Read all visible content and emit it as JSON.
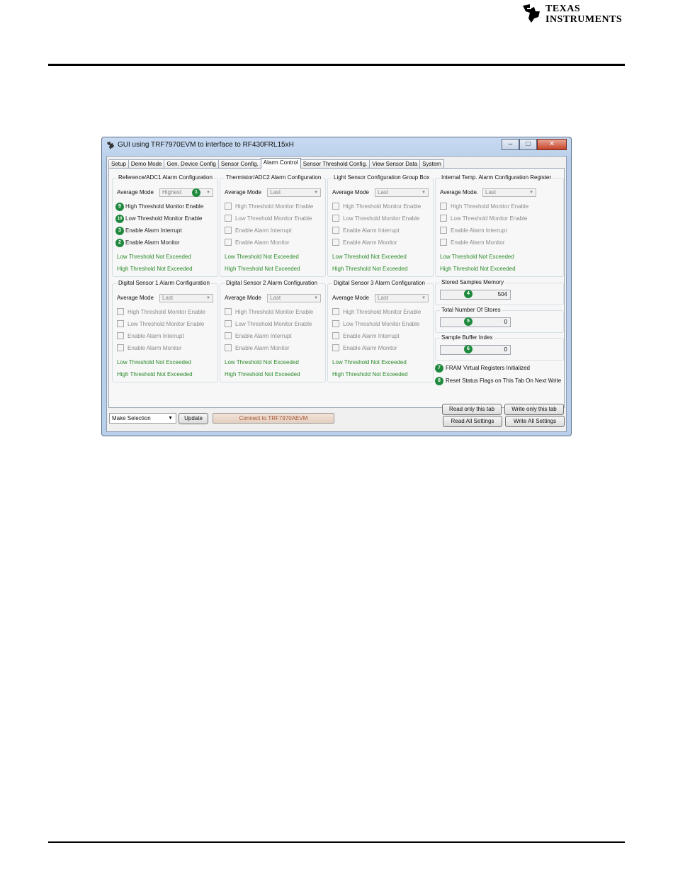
{
  "brand": {
    "word1": "TEXAS",
    "word2": "INSTRUMENTS"
  },
  "window": {
    "title": "GUI using TRF7970EVM to interface to RF430FRL15xH",
    "controls": {
      "minimize": "‒",
      "maximize": "□",
      "close": "✕"
    }
  },
  "tabs": [
    {
      "label": "Setup"
    },
    {
      "label": "Demo Mode"
    },
    {
      "label": "Gen. Device Config"
    },
    {
      "label": "Sensor Config."
    },
    {
      "label": "Alarm Control"
    },
    {
      "label": "Sensor Threshold Config."
    },
    {
      "label": "View Sensor Data"
    },
    {
      "label": "System"
    }
  ],
  "active_tab": "Alarm Control",
  "common": {
    "average_mode_label": "Average Mode",
    "high_threshold_enable": "High Threshold Monitor Enable",
    "low_threshold_enable": "Low Threshold Monitor Enable",
    "enable_alarm_interrupt": "Enable Alarm Interrupt",
    "enable_alarm_monitor": "Enable Alarm Monitor",
    "low_status": "Low Threshold Not Exceeded",
    "high_status": "High Threshold Not Exceeded"
  },
  "groups": [
    {
      "title": "Reference/ADC1 Alarm Configuration",
      "average_mode": "Highest",
      "average_mode_label": "Average Mode"
    },
    {
      "title": "Thermistor/ADC2 Alarm Configuration",
      "average_mode": "Last",
      "average_mode_label": "Average Mode"
    },
    {
      "title": "Light Sensor Configuration Group Box",
      "average_mode": "Last",
      "average_mode_label": "Average Mode"
    },
    {
      "title": "Internal Temp. Alarm Configuration Register",
      "average_mode": "Last",
      "average_mode_label": "Average Mode."
    },
    {
      "title": "Digital Sensor 1 Alarm Configuration",
      "average_mode": "Last",
      "average_mode_label": "Average Mode"
    },
    {
      "title": "Digital Sensor 2 Alarm Configuration",
      "average_mode": "Last",
      "average_mode_label": "Average Mode"
    },
    {
      "title": "Digital Sensor 3 Alarm Configuration",
      "average_mode": "Last",
      "average_mode_label": "Average Mode"
    }
  ],
  "badges": {
    "avg_mode": "1",
    "high_enable": "9",
    "low_enable": "10",
    "interrupt": "3",
    "monitor": "2",
    "stored": "4",
    "total": "5",
    "index": "6",
    "fram": "7",
    "reset": "8"
  },
  "memory": {
    "stored_samples": {
      "title": "Stored Samples Memory",
      "value": "504"
    },
    "total_stores": {
      "title": "Total Number Of Stores",
      "value": "0"
    },
    "sample_buffer_index": {
      "title": "Sample Buffer Index",
      "value": "0"
    },
    "fram_label": "FRAM Virtual Registers Initialized",
    "reset_label": "Reset Status Flags on This Tab On Next Write"
  },
  "buttons": {
    "read_tab": "Read only this tab",
    "write_tab": "Write only this tab",
    "read_all": "Read All Settings",
    "write_all": "Write All Settings",
    "update": "Update",
    "connect": "Connect to TRF7970AEVM"
  },
  "selection": {
    "value": "Make Selection",
    "arrow": "▼"
  }
}
